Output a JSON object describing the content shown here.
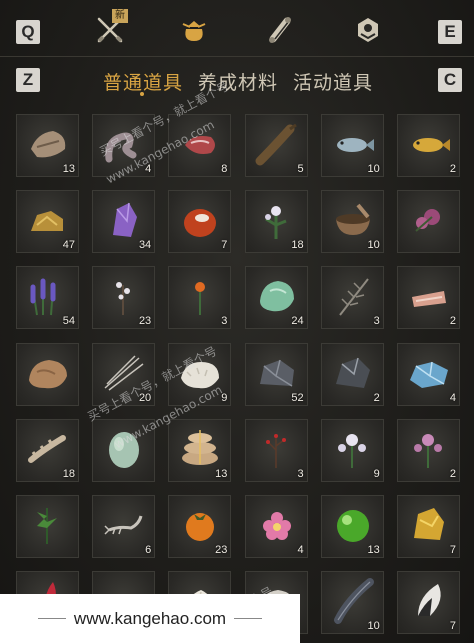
{
  "keys": {
    "left_top": "Q",
    "right_top": "E",
    "left_sub": "Z",
    "right_sub": "C"
  },
  "top_tabs": [
    {
      "icon": "crossed-swords-icon",
      "badge": "新"
    },
    {
      "icon": "pouch-icon",
      "active": true
    },
    {
      "icon": "scroll-icon"
    },
    {
      "icon": "medal-icon"
    }
  ],
  "sub_tabs": [
    "普通道具",
    "养成材料",
    "活动道具"
  ],
  "items": [
    {
      "icon": "wood-bark-icon",
      "qty": "13"
    },
    {
      "icon": "snake-skin-icon",
      "qty": "4"
    },
    {
      "icon": "raw-meat-icon",
      "qty": "8"
    },
    {
      "icon": "catfish-icon",
      "qty": "5"
    },
    {
      "icon": "silver-fish-icon",
      "qty": "10"
    },
    {
      "icon": "golden-carp-icon",
      "qty": "2"
    },
    {
      "icon": "gold-ore-icon",
      "qty": "47"
    },
    {
      "icon": "amethyst-icon",
      "qty": "34"
    },
    {
      "icon": "red-agate-icon",
      "qty": "7"
    },
    {
      "icon": "white-flower-herb-icon",
      "qty": "18"
    },
    {
      "icon": "mortar-icon",
      "qty": "10"
    },
    {
      "icon": "purple-flower-icon",
      "qty": ""
    },
    {
      "icon": "lavender-icon",
      "qty": "54"
    },
    {
      "icon": "white-blossom-icon",
      "qty": "23"
    },
    {
      "icon": "orange-flower-icon",
      "qty": "3"
    },
    {
      "icon": "jade-stone-icon",
      "qty": "24"
    },
    {
      "icon": "feather-grass-icon",
      "qty": "3"
    },
    {
      "icon": "meat-slices-icon",
      "qty": "2"
    },
    {
      "icon": "brown-rock-icon",
      "qty": ""
    },
    {
      "icon": "needles-icon",
      "qty": "20"
    },
    {
      "icon": "white-fur-icon",
      "qty": "9"
    },
    {
      "icon": "dark-ore-icon",
      "qty": "52"
    },
    {
      "icon": "obsidian-icon",
      "qty": "2"
    },
    {
      "icon": "blue-crystal-icon",
      "qty": "4"
    },
    {
      "icon": "bone-icon",
      "qty": "18"
    },
    {
      "icon": "jade-egg-icon",
      "qty": ""
    },
    {
      "icon": "rice-bags-icon",
      "qty": "13"
    },
    {
      "icon": "red-berry-branch-icon",
      "qty": "3"
    },
    {
      "icon": "white-chrysanthemum-icon",
      "qty": "9"
    },
    {
      "icon": "pink-chrysanthemum-icon",
      "qty": "2"
    },
    {
      "icon": "green-herb-icon",
      "qty": ""
    },
    {
      "icon": "scorpion-icon",
      "qty": "6"
    },
    {
      "icon": "persimmon-icon",
      "qty": "23"
    },
    {
      "icon": "pink-flower-icon",
      "qty": "4"
    },
    {
      "icon": "green-orb-icon",
      "qty": "13"
    },
    {
      "icon": "gold-nugget-icon",
      "qty": "7"
    },
    {
      "icon": "red-plume-icon",
      "qty": ""
    },
    {
      "icon": "empty-icon",
      "qty": ""
    },
    {
      "icon": "white-tuft-icon",
      "qty": ""
    },
    {
      "icon": "grey-stone-icon",
      "qty": ""
    },
    {
      "icon": "dark-feather-icon",
      "qty": "10"
    },
    {
      "icon": "black-white-feather-icon",
      "qty": "7"
    }
  ],
  "watermark": {
    "text1": "买号上看个号，就上看个号",
    "url": "www.kangehao.com",
    "logo_text": "看个号"
  },
  "footer": {
    "url": "www.kangehao.com"
  }
}
